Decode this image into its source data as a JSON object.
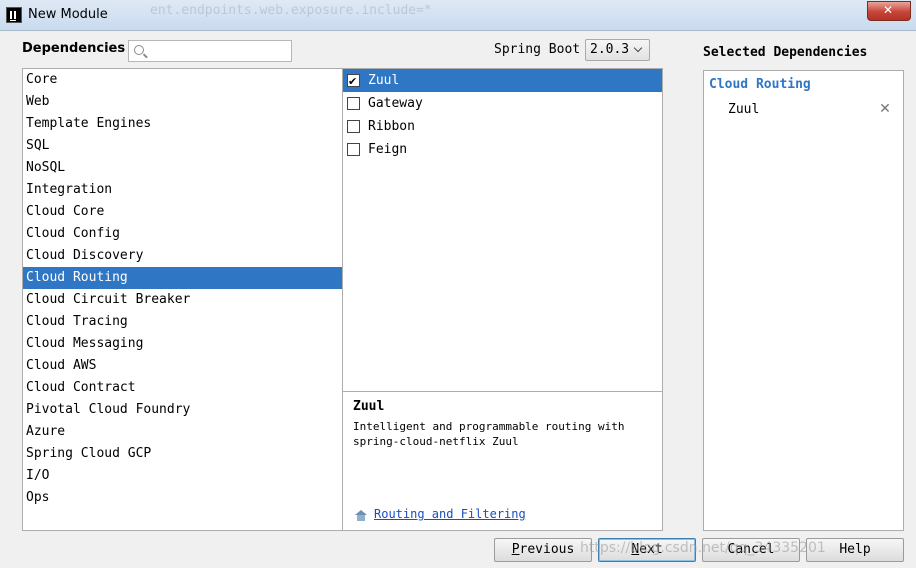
{
  "window": {
    "title": "New Module",
    "icon": "intellij-icon",
    "background_watermark": "ent.endpoints.web.exposure.include=*"
  },
  "header": {
    "dependencies_label": "Dependencies",
    "search_value": "",
    "search_placeholder": ""
  },
  "spring_boot": {
    "label": "Spring Boot",
    "version": "2.0.3"
  },
  "categories": [
    {
      "label": "Core"
    },
    {
      "label": "Web"
    },
    {
      "label": "Template Engines"
    },
    {
      "label": "SQL"
    },
    {
      "label": "NoSQL"
    },
    {
      "label": "Integration"
    },
    {
      "label": "Cloud Core"
    },
    {
      "label": "Cloud Config"
    },
    {
      "label": "Cloud Discovery"
    },
    {
      "label": "Cloud Routing",
      "selected": true
    },
    {
      "label": "Cloud Circuit Breaker"
    },
    {
      "label": "Cloud Tracing"
    },
    {
      "label": "Cloud Messaging"
    },
    {
      "label": "Cloud AWS"
    },
    {
      "label": "Cloud Contract"
    },
    {
      "label": "Pivotal Cloud Foundry"
    },
    {
      "label": "Azure"
    },
    {
      "label": "Spring Cloud GCP"
    },
    {
      "label": "I/O"
    },
    {
      "label": "Ops"
    }
  ],
  "dependencies": [
    {
      "label": "Zuul",
      "checked": true,
      "selected": true
    },
    {
      "label": "Gateway",
      "checked": false
    },
    {
      "label": "Ribbon",
      "checked": false
    },
    {
      "label": "Feign",
      "checked": false
    }
  ],
  "description": {
    "title": "Zuul",
    "text": "Intelligent and programmable routing with spring-cloud-netflix Zuul",
    "link_label": "Routing and Filtering",
    "link_icon": "home-icon"
  },
  "selected_dependencies": {
    "title": "Selected Dependencies",
    "group": "Cloud Routing",
    "items": [
      "Zuul"
    ],
    "remove_icon": "close-icon"
  },
  "buttons": {
    "previous": "revious",
    "next": "ext",
    "cancel": "Cancel",
    "help": "Help"
  },
  "watermark": "https://blog.csdn.net/qq_34335201",
  "colors": {
    "selection": "#2f77c4",
    "group_title": "#2f77c4",
    "link": "#1a4ec0"
  }
}
